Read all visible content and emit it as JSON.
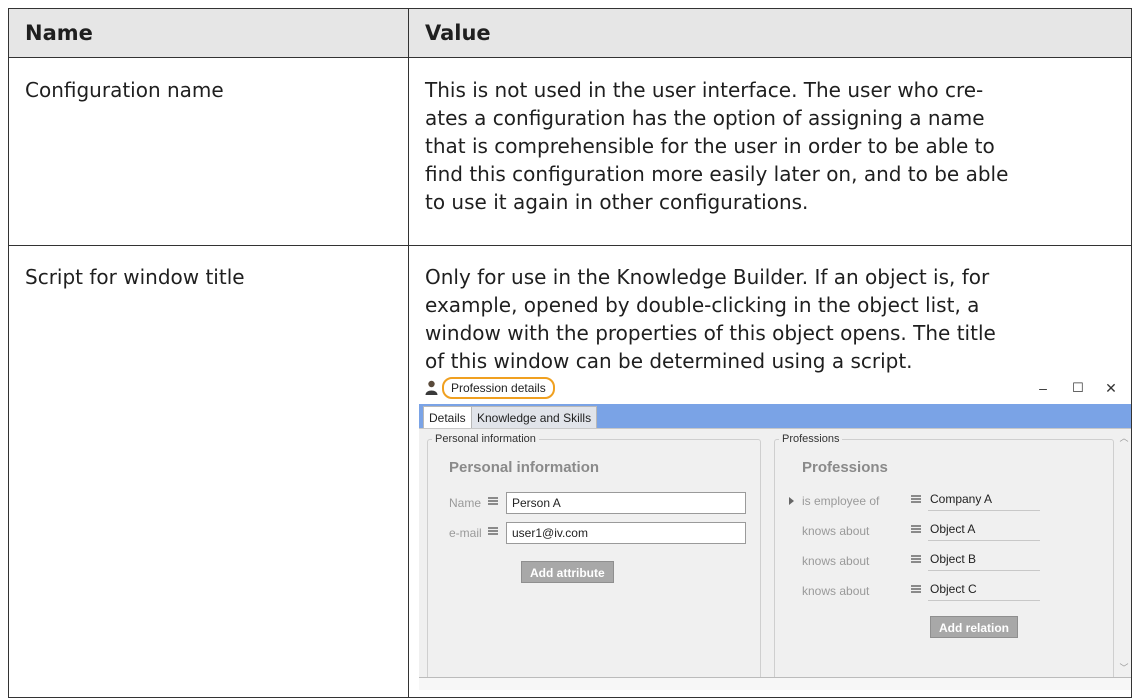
{
  "table": {
    "headers": {
      "name": "Name",
      "value": "Value"
    },
    "rows": [
      {
        "name": "Configuration name",
        "value_lines": [
          "This is not used in the user interface. The user who cre-",
          "ates a configuration has the option of assigning a name",
          "that is comprehensible for the user in order to be able to",
          "find this configuration more easily later on, and to be able",
          "to use it again in other configurations."
        ]
      },
      {
        "name": "Script for window title",
        "value_lines": [
          "Only for use in the Knowledge Builder. If an object is, for",
          "example, opened by double-clicking in the object list, a",
          "window with the properties of this object opens. The title",
          "of this window can be determined using a script."
        ]
      }
    ]
  },
  "window": {
    "title": "Profession details",
    "controls": {
      "minimize": "–",
      "maximize": "☐",
      "close": "✕"
    },
    "tabs": [
      "Details",
      "Knowledge and Skills"
    ],
    "personal": {
      "legend": "Personal information",
      "heading": "Personal information",
      "fields": [
        {
          "label": "Name",
          "value": "Person A"
        },
        {
          "label": "e-mail",
          "value": "user1@iv.com"
        }
      ],
      "button": "Add attribute"
    },
    "professions": {
      "legend": "Professions",
      "heading": "Professions",
      "relations": [
        {
          "label": "is employee of",
          "value": "Company A"
        },
        {
          "label": "knows about",
          "value": "Object A"
        },
        {
          "label": "knows about",
          "value": "Object B"
        },
        {
          "label": "knows about",
          "value": "Object C"
        }
      ],
      "button": "Add relation"
    },
    "accent_color": "#7aa3e6",
    "highlight_color": "#f0a020"
  }
}
